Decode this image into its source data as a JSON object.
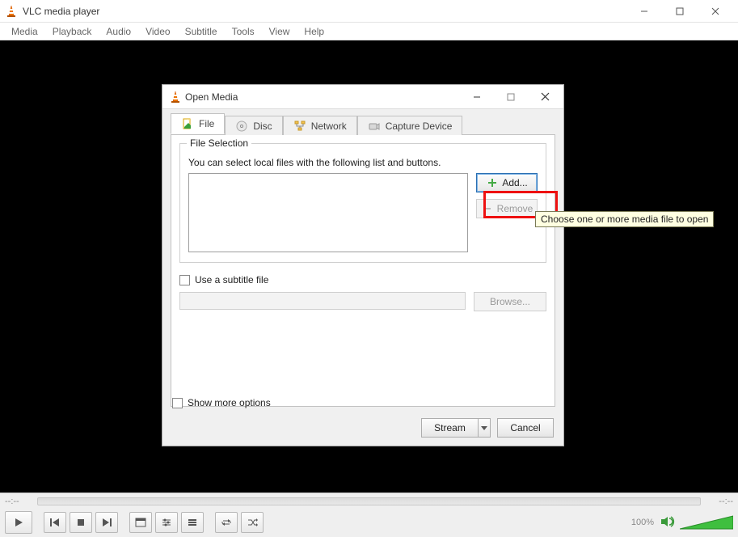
{
  "app": {
    "title": "VLC media player"
  },
  "menu": {
    "items": [
      "Media",
      "Playback",
      "Audio",
      "Video",
      "Subtitle",
      "Tools",
      "View",
      "Help"
    ]
  },
  "player": {
    "elapsed": "--:--",
    "remaining": "--:--",
    "volume_percent": "100%"
  },
  "dialog": {
    "title": "Open Media",
    "tabs": [
      {
        "id": "file",
        "label": "File"
      },
      {
        "id": "disc",
        "label": "Disc"
      },
      {
        "id": "network",
        "label": "Network"
      },
      {
        "id": "capture",
        "label": "Capture Device"
      }
    ],
    "file_tab": {
      "fieldset_legend": "File Selection",
      "help_text": "You can select local files with the following list and buttons.",
      "add_label": "Add...",
      "remove_label": "Remove",
      "use_subtitle_label": "Use a subtitle file",
      "browse_label": "Browse..."
    },
    "show_more_label": "Show more options",
    "stream_label": "Stream",
    "cancel_label": "Cancel",
    "tooltip": "Choose one or more media file to open"
  }
}
